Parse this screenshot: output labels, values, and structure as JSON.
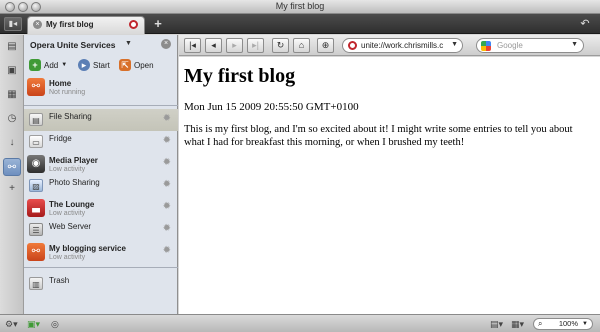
{
  "window": {
    "title": "My first blog"
  },
  "tabs": [
    {
      "label": "My first blog"
    }
  ],
  "panel": {
    "title": "Opera Unite Services",
    "actions": {
      "add": "Add",
      "start": "Start",
      "open": "Open"
    },
    "services": [
      {
        "name": "Home",
        "status": "Not running"
      },
      {
        "name": "File Sharing",
        "status": ""
      },
      {
        "name": "Fridge",
        "status": ""
      },
      {
        "name": "Media Player",
        "status": "Low activity"
      },
      {
        "name": "Photo Sharing",
        "status": ""
      },
      {
        "name": "The Lounge",
        "status": "Low activity"
      },
      {
        "name": "Web Server",
        "status": ""
      },
      {
        "name": "My blogging service",
        "status": "Low activity"
      },
      {
        "name": "Trash",
        "status": ""
      }
    ]
  },
  "toolbar": {
    "address": "unite://work.chrismills.c",
    "search_placeholder": "Google"
  },
  "page": {
    "heading": "My first blog",
    "date": "Mon Jun 15 2009 20:55:50 GMT+0100",
    "body": "This is my first blog, and I'm so excited about it! I might write some entries to tell you about what I had for breakfast this morning, or when I brushed my teeth!"
  },
  "statusbar": {
    "zoom": "100%"
  },
  "colors": {
    "accent": "#c0262d",
    "selection": "#c4c4b8",
    "panel_bg": "#dfe4ec"
  }
}
